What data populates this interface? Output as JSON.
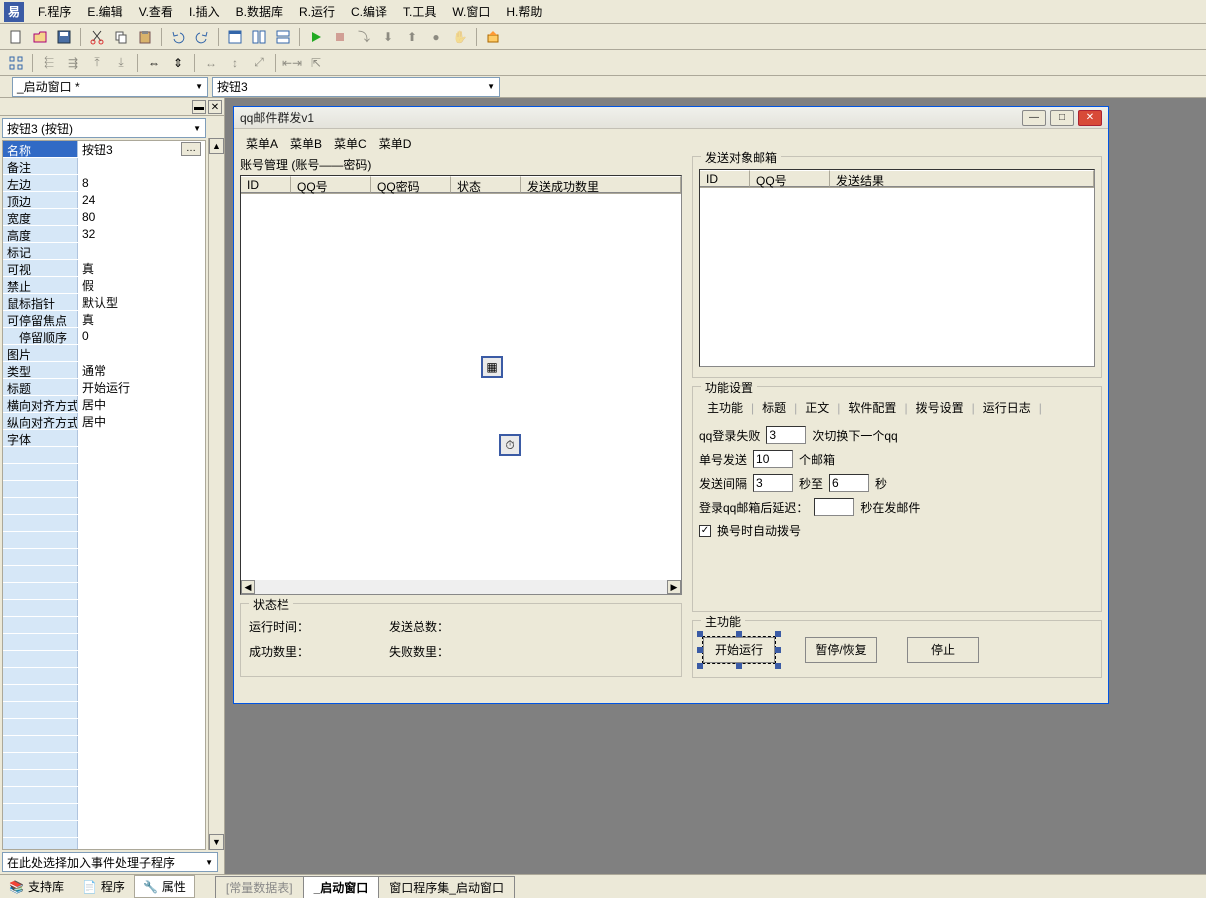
{
  "menubar": {
    "items": [
      "F.程序",
      "E.编辑",
      "V.查看",
      "I.插入",
      "B.数据库",
      "R.运行",
      "C.编译",
      "T.工具",
      "W.窗口",
      "H.帮助"
    ]
  },
  "dropdowns": {
    "left": "_启动窗口 *",
    "right": "按钮3"
  },
  "props_combo": "按钮3 (按钮)",
  "properties": [
    {
      "k": "名称",
      "v": "按钮3",
      "sel": true,
      "dots": true
    },
    {
      "k": "备注",
      "v": ""
    },
    {
      "k": "左边",
      "v": "8"
    },
    {
      "k": "顶边",
      "v": "24"
    },
    {
      "k": "宽度",
      "v": "80"
    },
    {
      "k": "高度",
      "v": "32"
    },
    {
      "k": "标记",
      "v": ""
    },
    {
      "k": "可视",
      "v": "真"
    },
    {
      "k": "禁止",
      "v": "假"
    },
    {
      "k": "鼠标指针",
      "v": "默认型"
    },
    {
      "k": "可停留焦点",
      "v": "真"
    },
    {
      "k": "停留顺序",
      "v": "0",
      "indent": true
    },
    {
      "k": "图片",
      "v": ""
    },
    {
      "k": "类型",
      "v": "通常"
    },
    {
      "k": "标题",
      "v": "开始运行"
    },
    {
      "k": "横向对齐方式",
      "v": "居中"
    },
    {
      "k": "纵向对齐方式",
      "v": "居中"
    },
    {
      "k": "字体",
      "v": ""
    }
  ],
  "event_combo": "在此处选择加入事件处理子程序",
  "dw": {
    "title": "qq邮件群发v1",
    "menus": [
      "菜单A",
      "菜单B",
      "菜单C",
      "菜单D"
    ],
    "accounts_label": "账号管理 (账号——密码)",
    "accounts_cols": [
      "ID",
      "QQ号",
      "QQ密码",
      "状态",
      "发送成功数里"
    ],
    "targets_label": "发送对象邮箱",
    "targets_cols": [
      "ID",
      "QQ号",
      "发送结果"
    ],
    "status_box": "状态栏",
    "status_run": "运行时间：",
    "status_sent": "发送总数：",
    "status_ok": "成功数里：",
    "status_fail": "失败数里：",
    "settings_label": "功能设置",
    "tabs": [
      "主功能",
      "标题",
      "正文",
      "软件配置",
      "拨号设置",
      "运行日志"
    ],
    "s1a": "qq登录失败",
    "s1v": "3",
    "s1b": "次切换下一个qq",
    "s2a": "单号发送",
    "s2v": "10",
    "s2b": "个邮箱",
    "s3a": "发送间隔",
    "s3v1": "3",
    "s3m": "秒至",
    "s3v2": "6",
    "s3b": "秒",
    "s4a": "登录qq邮箱后延迟：",
    "s4v": "",
    "s4b": "秒在发邮件",
    "s5cb": true,
    "s5a": "换号时自动拨号",
    "mainbox": "主功能",
    "btn1": "开始运行",
    "btn2": "暂停/恢复",
    "btn3": "停止"
  },
  "bottom": {
    "panes": [
      "支持库",
      "程序",
      "属性"
    ],
    "tabs": [
      "[常量数据表]",
      "_启动窗口",
      "窗口程序集_启动窗口"
    ]
  }
}
